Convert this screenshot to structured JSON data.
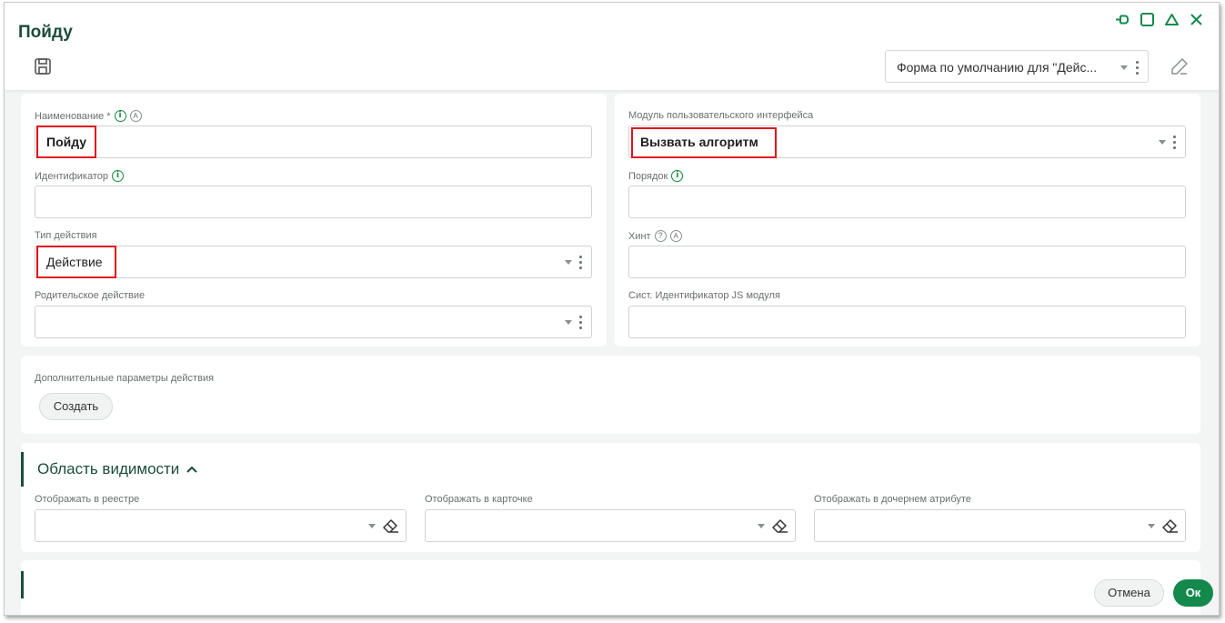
{
  "window": {
    "title": "Пойду",
    "controls": [
      "pin-icon",
      "maximize-icon",
      "collapse-icon",
      "close-icon"
    ]
  },
  "toolbar": {
    "form_select_value": "Форма по умолчанию для \"Дейс..."
  },
  "main_card": {
    "name_label": "Наименование *",
    "name_value": "Пойду",
    "identifier_label": "Идентификатор",
    "identifier_value": "",
    "action_type_label": "Тип действия",
    "action_type_value": "Действие",
    "parent_action_label": "Родительское действие",
    "parent_action_value": "",
    "ui_module_label": "Модуль пользовательского интерфейса",
    "ui_module_value": "Вызвать алгоритм",
    "order_label": "Порядок",
    "order_value": "",
    "hint_label": "Хинт",
    "hint_value": "",
    "js_module_label": "Сист. Идентификатор JS модуля",
    "js_module_value": ""
  },
  "params_card": {
    "label": "Дополнительные параметры действия",
    "create_button": "Создать"
  },
  "visibility": {
    "title": "Область видимости",
    "registry_label": "Отображать в реестре",
    "card_label": "Отображать в карточке",
    "child_attr_label": "Отображать в дочернем атрибуте"
  },
  "footer": {
    "cancel": "Отмена",
    "ok": "Ок"
  },
  "colors": {
    "accent": "#138a4c",
    "title": "#1c4c3c",
    "highlight": "#e0141e"
  }
}
